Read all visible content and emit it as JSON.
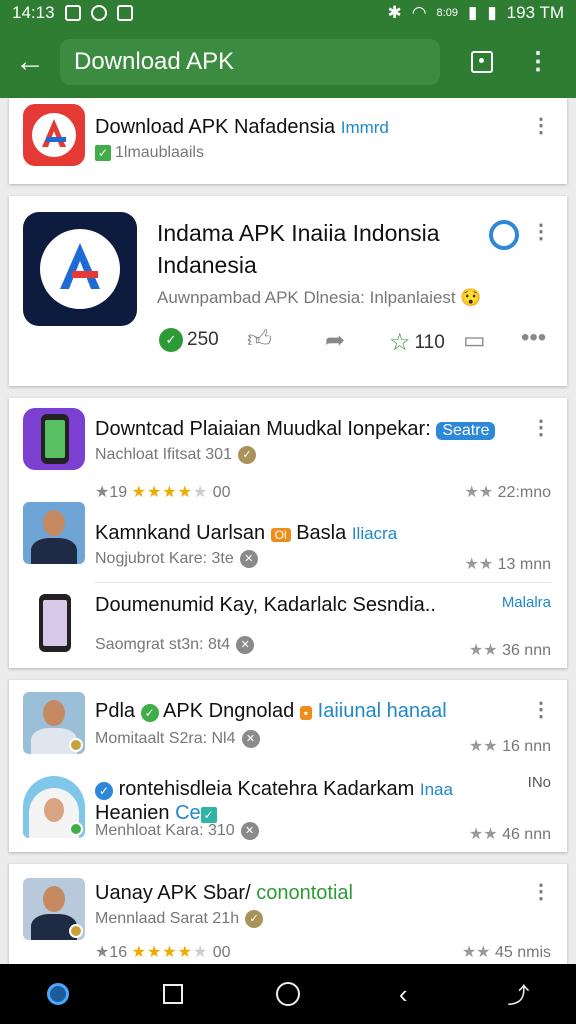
{
  "status_bar": {
    "time": "14:13",
    "right_text": "193 TM",
    "signal_text": "8:09"
  },
  "app_bar": {
    "search_text": "Download APK"
  },
  "top_item": {
    "title": "Download APK Nafadensia",
    "tag": "Immrd",
    "sub": "1lmaublaails"
  },
  "featured": {
    "title_line1": "Indama APK Inaiia Indonsia",
    "title_line2": "Indanesia",
    "sub": "Auwnpambad APK Dlnesia: Inlpanlaiest",
    "likes": "250",
    "stars": "110"
  },
  "group1": {
    "items": [
      {
        "title": "Downtcad Plaiaian Muudkal Ionpekar:",
        "badge": "Seatre",
        "sub": "Nachloat Ifitsat 301",
        "rating": "19",
        "rating_tail": "00",
        "right": "22:mno"
      },
      {
        "title": "Kamnkand Uarlsan",
        "badge": "Ol",
        "title2": "Basla",
        "tag": "Iliacra",
        "sub": "Nogjubrot Kare: 3te",
        "right": "13 mnn"
      },
      {
        "title": "Doumenumid Kay, Kadarlalc Sesndia..",
        "tag": "Malalra",
        "sub": "Saomgrat st3n: 8t4",
        "right": "36 nnn"
      }
    ]
  },
  "group2": {
    "items": [
      {
        "title_a": "Pdla",
        "title_b": "APK Dngnolad",
        "tag": "Iaiiunal hanaal",
        "sub": "Momitaalt S2ra: Nl4",
        "right": "16 nnn"
      },
      {
        "title": "rontehisdleia Kcatehra Kadarkam",
        "tag": "Inaa",
        "right_tag": "INo",
        "line2": "Heanien",
        "line2_badge": "Ce",
        "sub": "Menhloat Kara: 310",
        "right": "46 nnn"
      }
    ]
  },
  "group3": {
    "items": [
      {
        "title_a": "Uanay APK Sbar/",
        "title_b": "conontotial",
        "sub": "Mennlaad Sarat 21h",
        "rating": "16",
        "rating_tail": "00",
        "right": "45 nmis"
      }
    ]
  },
  "colors": {
    "primary": "#2e7d32",
    "accent_blue": "#1e88c8",
    "accent_green": "#2e9a36",
    "star_gold": "#f2a900"
  }
}
